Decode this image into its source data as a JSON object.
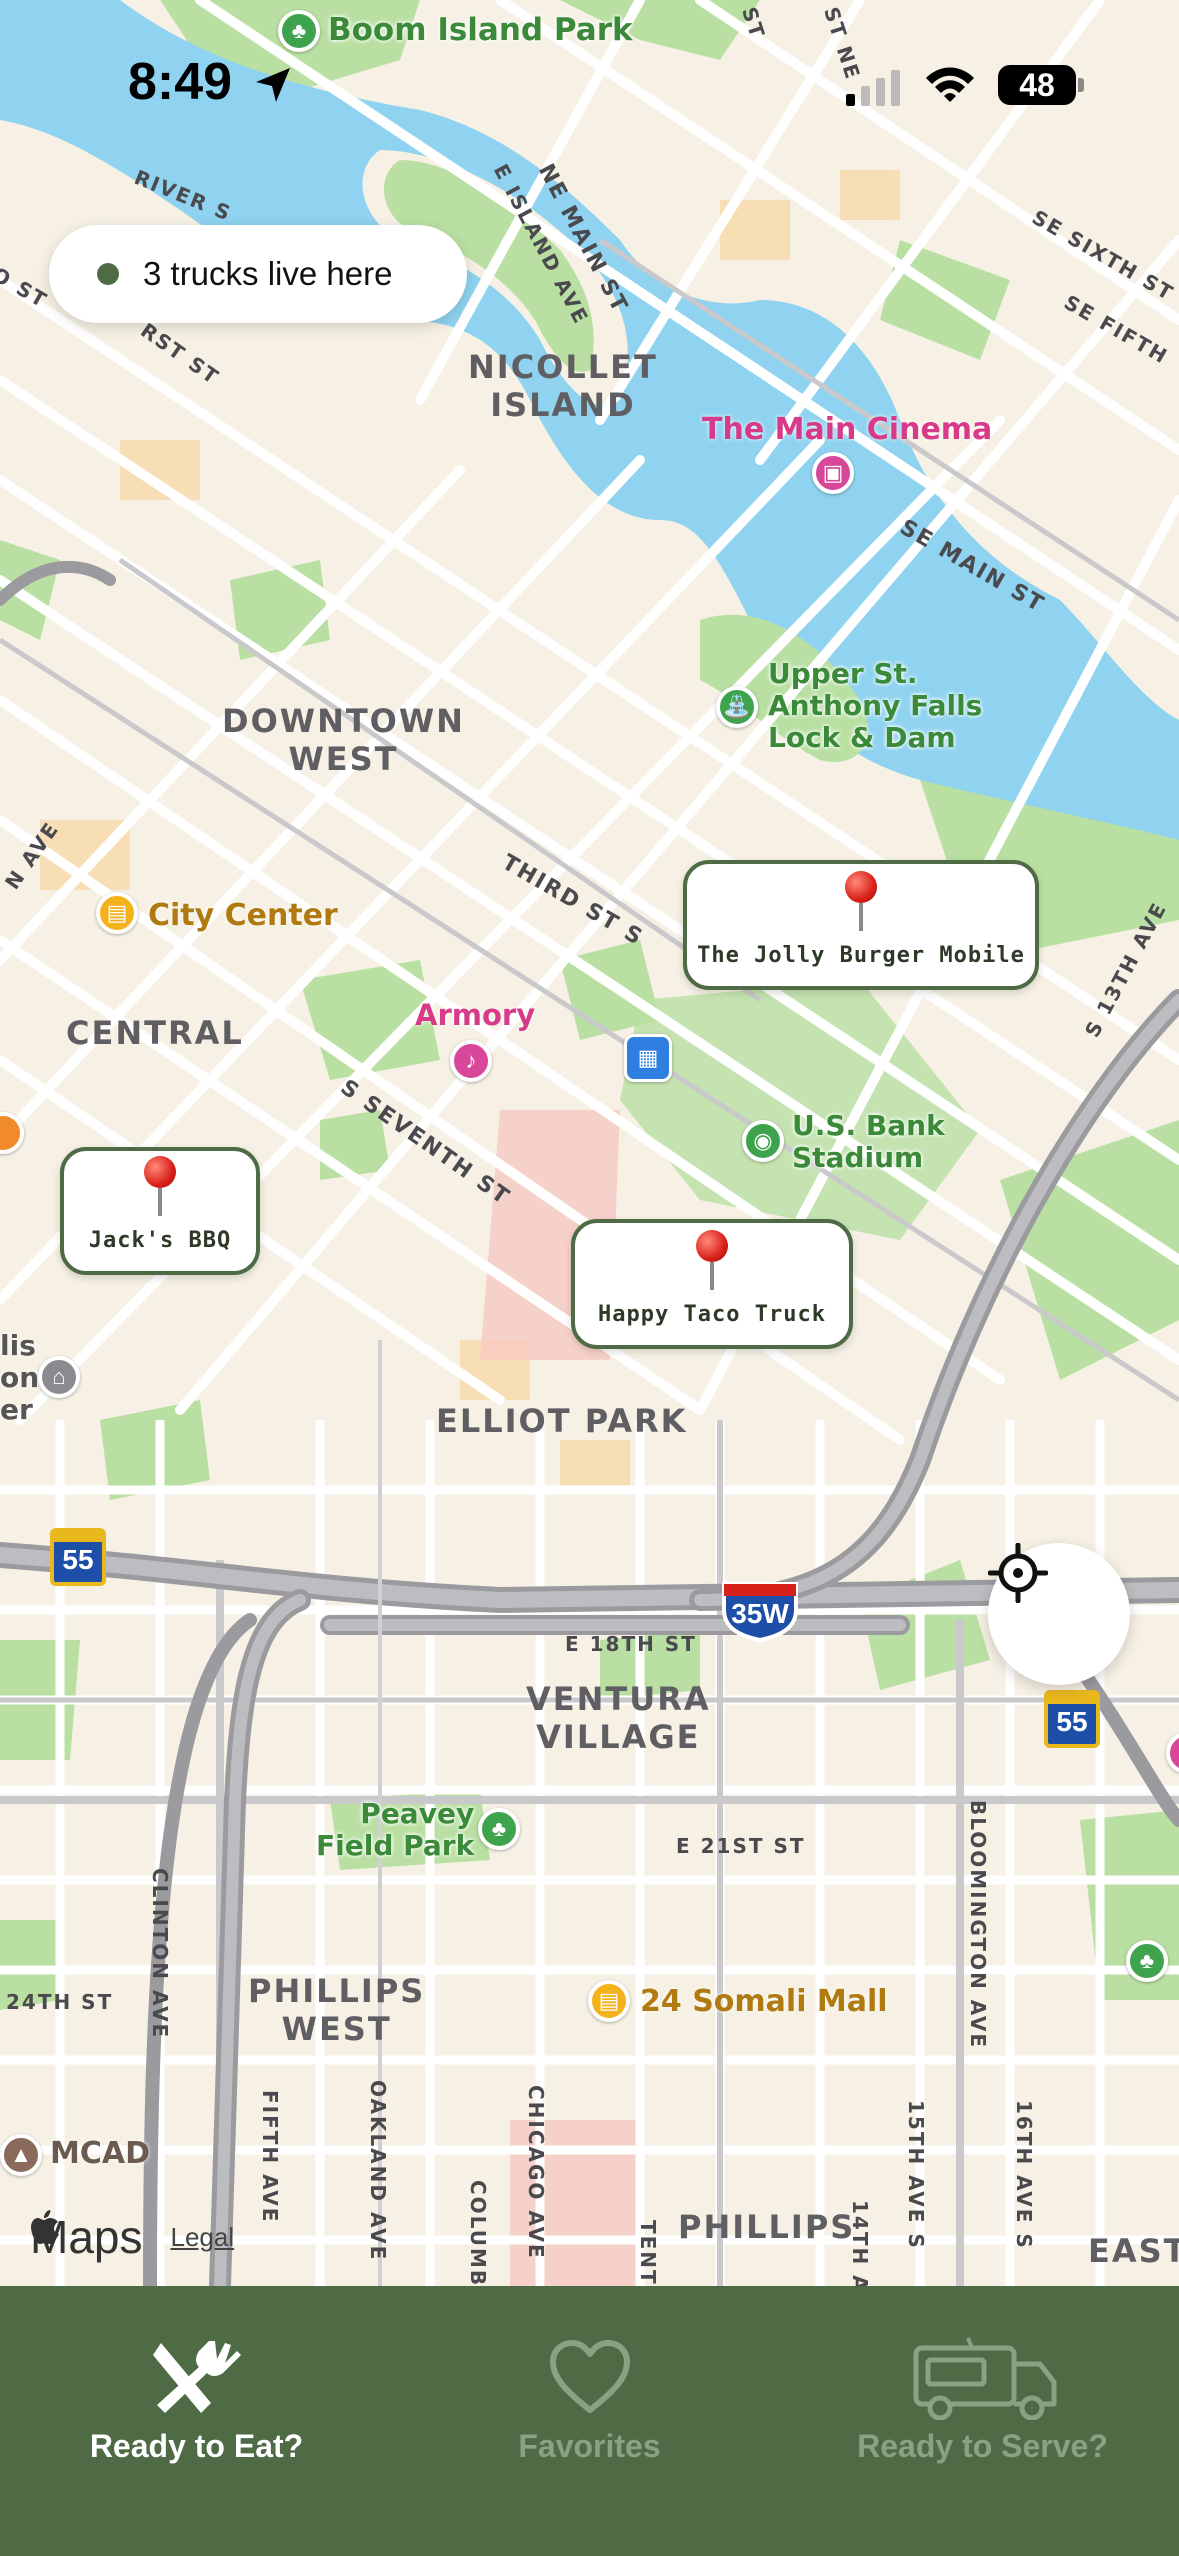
{
  "status_bar": {
    "time": "8:49",
    "battery": "48"
  },
  "trucks_pill": {
    "text": "3 trucks live here"
  },
  "map": {
    "districts": [
      {
        "text": "NICOLLET\nISLAND"
      },
      {
        "text": "DOWNTOWN\nWEST"
      },
      {
        "text": "CENTRAL"
      },
      {
        "text": "ELLIOT PARK"
      },
      {
        "text": "VENTURA\nVILLAGE"
      },
      {
        "text": "PHILLIPS\nWEST"
      },
      {
        "text": "PHILLIPS"
      },
      {
        "text": "EAST"
      }
    ],
    "streets": {
      "ne_main": "NE MAIN ST",
      "e_island": "E ISLAND AVE",
      "river": "RIVER S",
      "se_sixth": "SE SIXTH ST",
      "se_fifth": "SE FIFTH",
      "se_main": "SE MAIN ST",
      "third": "THIRD ST S",
      "s_seventh": "S SEVENTH ST",
      "s13th": "S 13TH AVE",
      "e18th": "E 18TH ST",
      "e21st": "E 21ST ST",
      "bloomington": "BLOOMINGTON AVE",
      "clinton": "CLINTON AVE",
      "fifth_ave": "FIFTH AVE",
      "oakland": "OAKLAND AVE",
      "chicago": "CHICAGO AVE",
      "columbus": "COLUMB",
      "tenth": "TENT",
      "fourteenth": "14TH A",
      "fifteenth": "15TH AVE S",
      "sixteenth": "16TH AVE S",
      "twentyfourth": "24TH ST",
      "n_ave": "N AVE",
      "o_st": "O ST",
      "rst_st": "RST ST",
      "st_ne": "ST NE",
      "st": "ST"
    },
    "pois": {
      "boom_island": "Boom Island Park",
      "main_cinema": "The Main Cinema",
      "upper_st_anthony": "Upper St.\nAnthony Falls\nLock & Dam",
      "city_center": "City Center",
      "armory": "Armory",
      "us_bank": "U.S. Bank\nStadium",
      "peavey": "Peavey\nField Park",
      "somali_mall": "24 Somali Mall",
      "mcad": "MCAD",
      "edge_lis": "lis\non\ner"
    },
    "highways": {
      "i55_left": "55",
      "i35w": "35W",
      "i55_right": "55"
    }
  },
  "food_trucks": [
    {
      "name": "The Jolly Burger Mobile"
    },
    {
      "name": "Jack's BBQ"
    },
    {
      "name": "Happy Taco Truck"
    }
  ],
  "attribution": {
    "maps": "Maps",
    "legal": "Legal"
  },
  "tabs": [
    {
      "label": "Ready to Eat?",
      "icon": "fork-knife-icon",
      "active": true
    },
    {
      "label": "Favorites",
      "icon": "heart-icon",
      "active": false
    },
    {
      "label": "Ready to Serve?",
      "icon": "food-truck-icon",
      "active": false
    }
  ],
  "colors": {
    "brand": "#4f6b46",
    "water": "#8fd3f0",
    "park": "#b9e0a2",
    "land": "#f6f1e4",
    "pin": "#d8201a"
  }
}
